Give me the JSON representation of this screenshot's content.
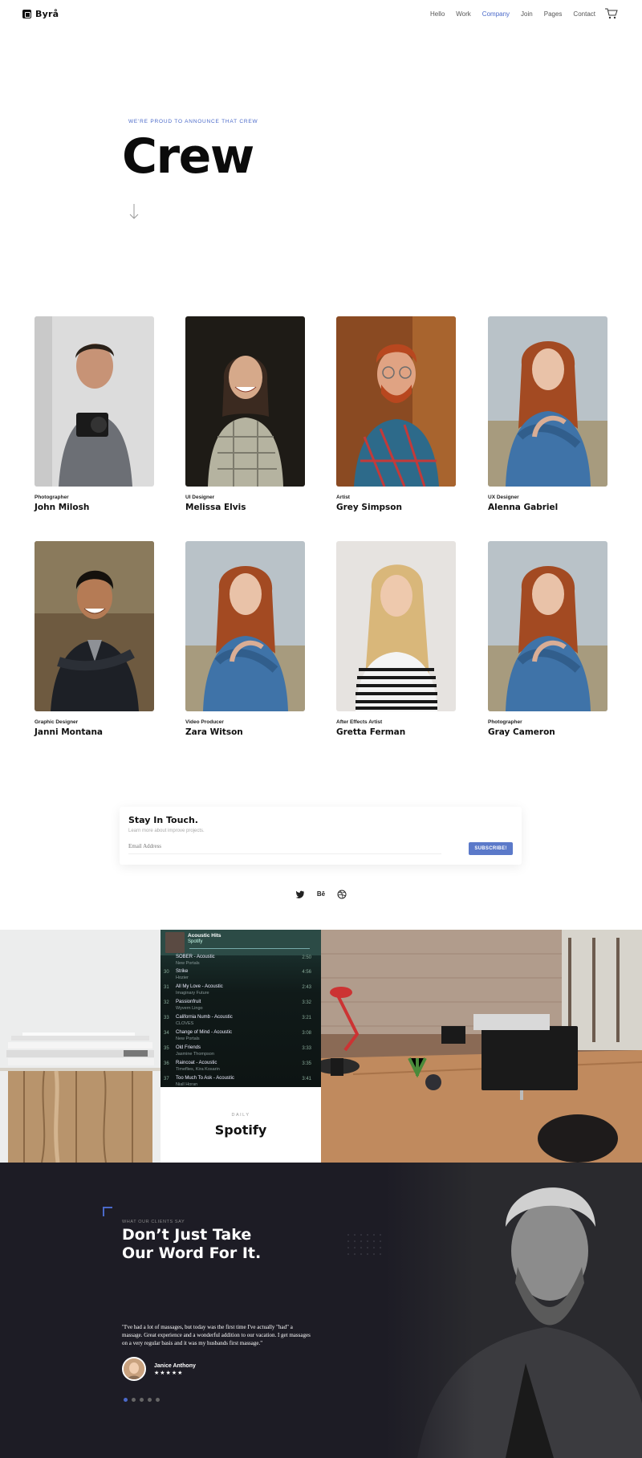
{
  "header": {
    "brand": "Byrå",
    "nav": [
      "Hello",
      "Work",
      "Company",
      "Join",
      "Pages",
      "Contact"
    ],
    "active_nav": "Company"
  },
  "hero": {
    "eyebrow": "WE'RE PROUD TO ANNOUNCE THAT CREW",
    "title": "Crew"
  },
  "crew": [
    {
      "role": "Photographer",
      "name": "John Milosh"
    },
    {
      "role": "UI Designer",
      "name": "Melissa Elvis"
    },
    {
      "role": "Artist",
      "name": "Grey Simpson"
    },
    {
      "role": "UX Designer",
      "name": "Alenna Gabriel"
    },
    {
      "role": "Graphic Designer",
      "name": "Janni Montana"
    },
    {
      "role": "Video Producer",
      "name": "Zara Witson"
    },
    {
      "role": "After Effects Artist",
      "name": "Gretta Ferman"
    },
    {
      "role": "Photographer",
      "name": "Gray Cameron"
    }
  ],
  "subscribe": {
    "title": "Stay In Touch.",
    "text": "Learn more about improve projects.",
    "placeholder": "Email Address",
    "button": "SUBSCRIBE!"
  },
  "social": [
    "twitter-icon",
    "behance-icon",
    "dribbble-icon"
  ],
  "spotify": {
    "playlist": "Acoustic Hits",
    "app": "Spotify",
    "tracks": [
      {
        "num": "",
        "name": "SOBER - Acoustic",
        "artist": "New Portals",
        "time": "2:50"
      },
      {
        "num": "30",
        "name": "Strike",
        "artist": "Hozier",
        "time": "4:56"
      },
      {
        "num": "31",
        "name": "All My Love - Acoustic",
        "artist": "Imaginary Future",
        "time": "2:43"
      },
      {
        "num": "32",
        "name": "Passionfruit",
        "artist": "Wyvern Lingo",
        "time": "3:32"
      },
      {
        "num": "33",
        "name": "California Numb - Acoustic",
        "artist": "CLOVES",
        "time": "3:21"
      },
      {
        "num": "34",
        "name": "Change of Mind - Acoustic",
        "artist": "New Portals",
        "time": "3:08"
      },
      {
        "num": "35",
        "name": "Old Friends",
        "artist": "Jasmine Thompson",
        "time": "3:33"
      },
      {
        "num": "36",
        "name": "Raincoat - Acoustic",
        "artist": "Timeflies, Kira Kosarin",
        "time": "3:35"
      },
      {
        "num": "37",
        "name": "Too Much To Ask - Acoustic",
        "artist": "Niall Horan",
        "time": "3:41"
      }
    ],
    "caption_small": "DAILY",
    "caption": "Spotify"
  },
  "testimonials": {
    "eyebrow": "WHAT OUR CLIENTS SAY",
    "title": "Don’t Just Take Our Word For It.",
    "quote": "\"I've had a lot of massages, but today was the first time I've actually \"had\" a massage. Great experience and a wonderful addition to our vacation. I get massages on a very regular basis and it was my husbands first massage.\"",
    "author": "Janice Anthony",
    "stars": "★★★★★",
    "rating": 5,
    "slides": 5,
    "active_slide": 1
  },
  "colors": {
    "accent": "#4a69c9",
    "dark_bg": "#1d1c25",
    "button": "#5b79c9"
  }
}
